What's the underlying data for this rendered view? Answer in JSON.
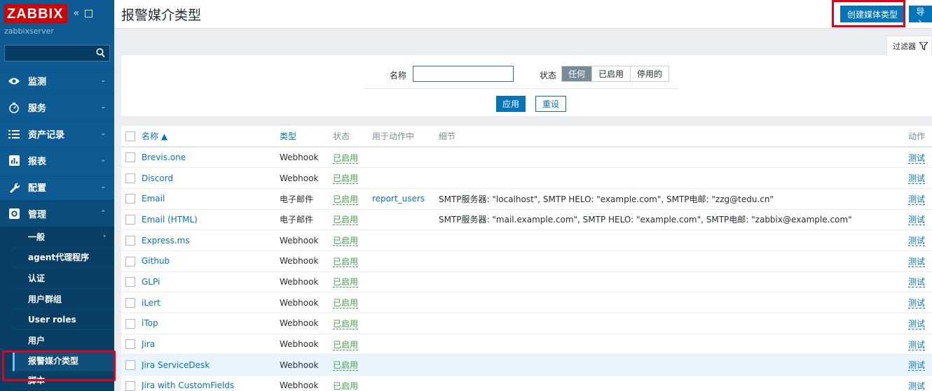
{
  "sidebar": {
    "logo": "ZABBIX",
    "server_name": "zabbixserver",
    "search_placeholder": "",
    "menu": [
      {
        "label": "监测",
        "icon": "eye-icon"
      },
      {
        "label": "服务",
        "icon": "stopwatch-icon"
      },
      {
        "label": "资产记录",
        "icon": "list-icon"
      },
      {
        "label": "报表",
        "icon": "bar-chart-icon"
      },
      {
        "label": "配置",
        "icon": "wrench-icon"
      },
      {
        "label": "管理",
        "icon": "gear-icon"
      }
    ],
    "admin_submenu": [
      "一般",
      "agent代理程序",
      "认证",
      "用户群组",
      "User roles",
      "用户",
      "报警媒介类型",
      "脚本"
    ]
  },
  "header": {
    "title": "报警媒介类型",
    "create_label": "创建媒体类型",
    "import_label": "导入"
  },
  "filter": {
    "tab_label": "过滤器",
    "name_label": "名称",
    "name_value": "",
    "status_label": "状态",
    "status_options": [
      "任何",
      "已启用",
      "停用的"
    ],
    "status_selected": "任何",
    "apply_label": "应用",
    "reset_label": "重设"
  },
  "table": {
    "headers": {
      "name": "名称 ▲",
      "type": "类型",
      "status": "状态",
      "used_in_actions": "用于动作中",
      "details": "细节",
      "action": "动作"
    },
    "rows": [
      {
        "name": "Brevis.one",
        "type": "Webhook",
        "status": "已启用",
        "used": "",
        "details": "",
        "action": "测试"
      },
      {
        "name": "Discord",
        "type": "Webhook",
        "status": "已启用",
        "used": "",
        "details": "",
        "action": "测试"
      },
      {
        "name": "Email",
        "type": "电子邮件",
        "status": "已启用",
        "used": "report_users",
        "details": "SMTP服务器: \"localhost\", SMTP HELO: \"example.com\", SMTP电邮: \"zzg@tedu.cn\"",
        "action": "测试"
      },
      {
        "name": "Email (HTML)",
        "type": "电子邮件",
        "status": "已启用",
        "used": "",
        "details": "SMTP服务器: \"mail.example.com\", SMTP HELO: \"example.com\", SMTP电邮: \"zabbix@example.com\"",
        "action": "测试"
      },
      {
        "name": "Express.ms",
        "type": "Webhook",
        "status": "已启用",
        "used": "",
        "details": "",
        "action": "测试"
      },
      {
        "name": "Github",
        "type": "Webhook",
        "status": "已启用",
        "used": "",
        "details": "",
        "action": "测试"
      },
      {
        "name": "GLPi",
        "type": "Webhook",
        "status": "已启用",
        "used": "",
        "details": "",
        "action": "测试"
      },
      {
        "name": "iLert",
        "type": "Webhook",
        "status": "已启用",
        "used": "",
        "details": "",
        "action": "测试"
      },
      {
        "name": "iTop",
        "type": "Webhook",
        "status": "已启用",
        "used": "",
        "details": "",
        "action": "测试"
      },
      {
        "name": "Jira",
        "type": "Webhook",
        "status": "已启用",
        "used": "",
        "details": "",
        "action": "测试"
      },
      {
        "name": "Jira ServiceDesk",
        "type": "Webhook",
        "status": "已启用",
        "used": "",
        "details": "",
        "action": "测试"
      },
      {
        "name": "Jira with CustomFields",
        "type": "Webhook",
        "status": "已启用",
        "used": "",
        "details": "",
        "action": "测试"
      }
    ]
  },
  "colors": {
    "sidebar": "#0d5b92",
    "accent": "#0275b8",
    "enabled": "#429e47",
    "highlight": "#e2001a"
  }
}
